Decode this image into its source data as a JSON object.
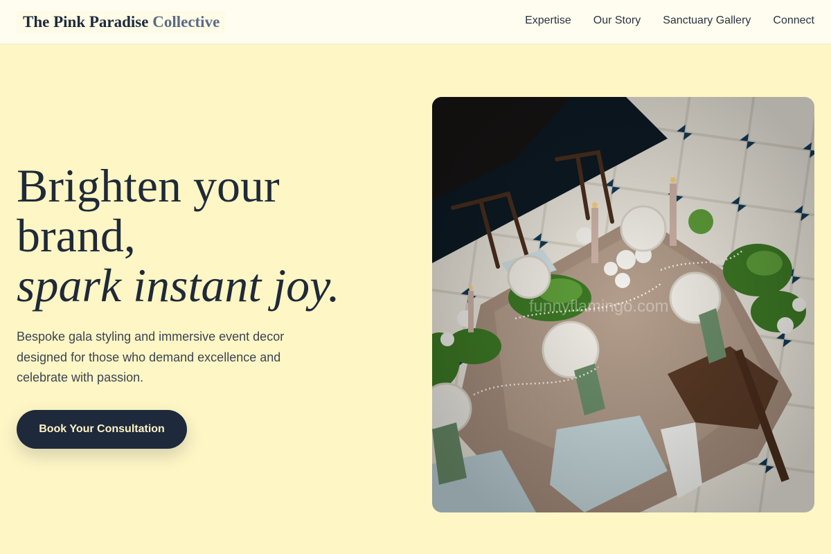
{
  "header": {
    "brand_main": "The Pink Paradise",
    "brand_accent": "Collective",
    "nav": [
      {
        "label": "Expertise"
      },
      {
        "label": "Our Story"
      },
      {
        "label": "Sanctuary Gallery"
      },
      {
        "label": "Connect"
      }
    ]
  },
  "hero": {
    "headline_line1": "Brighten your",
    "headline_line2": "brand,",
    "headline_line3": "spark instant joy.",
    "subtext": "Bespoke gala styling and immersive event decor designed for those who demand excellence and celebrate with passion.",
    "cta_label": "Book Your Consultation",
    "image_alt": "Elegant dining table set with taupe linen, white flowers, greenery, candles and plates, viewed from above",
    "image_watermark": "funnyflamingo.com"
  },
  "colors": {
    "background": "#fef6c5",
    "header_bg": "#fefdef",
    "navy": "#1e293b",
    "brand_accent": "#5b6b86",
    "cta_text": "#fef3c7"
  }
}
